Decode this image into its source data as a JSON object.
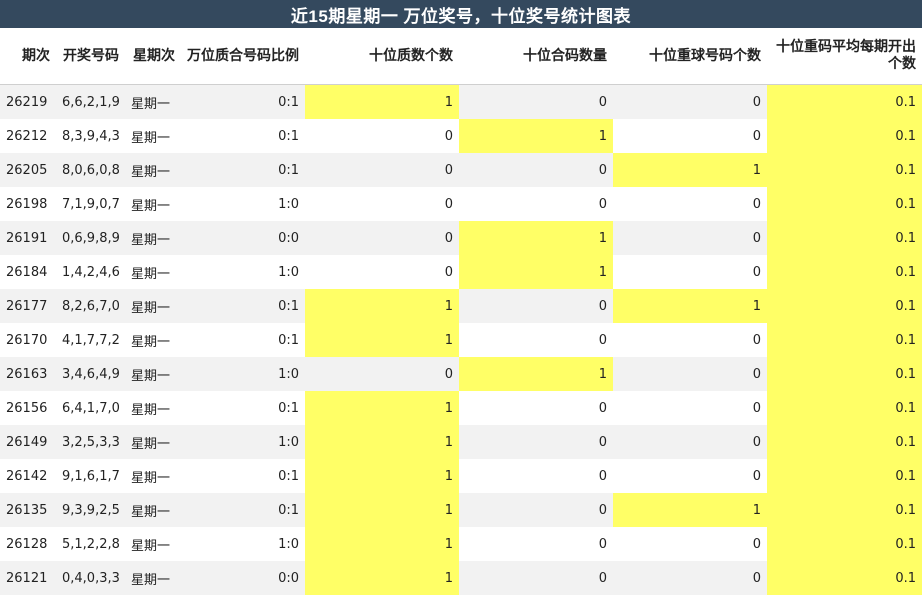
{
  "title": "近15期星期一 万位奖号，十位奖号统计图表",
  "highlight_color": "#ffff66",
  "header_color": "#34495e",
  "columns": [
    "期次",
    "开奖号码",
    "星期次",
    "万位质合号码比例",
    "十位质数个数",
    "十位合码数量",
    "十位重球号码个数",
    "十位重码平均每期开出个数"
  ],
  "rows": [
    {
      "period": "26219",
      "numbers": "6,6,2,1,9",
      "weekday": "星期一",
      "ratio": "0:1",
      "prime_count": "1",
      "composite_count": "0",
      "repeat_count": "0",
      "repeat_avg": "0.1"
    },
    {
      "period": "26212",
      "numbers": "8,3,9,4,3",
      "weekday": "星期一",
      "ratio": "0:1",
      "prime_count": "0",
      "composite_count": "1",
      "repeat_count": "0",
      "repeat_avg": "0.1"
    },
    {
      "period": "26205",
      "numbers": "8,0,6,0,8",
      "weekday": "星期一",
      "ratio": "0:1",
      "prime_count": "0",
      "composite_count": "0",
      "repeat_count": "1",
      "repeat_avg": "0.1"
    },
    {
      "period": "26198",
      "numbers": "7,1,9,0,7",
      "weekday": "星期一",
      "ratio": "1:0",
      "prime_count": "0",
      "composite_count": "0",
      "repeat_count": "0",
      "repeat_avg": "0.1"
    },
    {
      "period": "26191",
      "numbers": "0,6,9,8,9",
      "weekday": "星期一",
      "ratio": "0:0",
      "prime_count": "0",
      "composite_count": "1",
      "repeat_count": "0",
      "repeat_avg": "0.1"
    },
    {
      "period": "26184",
      "numbers": "1,4,2,4,6",
      "weekday": "星期一",
      "ratio": "1:0",
      "prime_count": "0",
      "composite_count": "1",
      "repeat_count": "0",
      "repeat_avg": "0.1"
    },
    {
      "period": "26177",
      "numbers": "8,2,6,7,0",
      "weekday": "星期一",
      "ratio": "0:1",
      "prime_count": "1",
      "composite_count": "0",
      "repeat_count": "1",
      "repeat_avg": "0.1"
    },
    {
      "period": "26170",
      "numbers": "4,1,7,7,2",
      "weekday": "星期一",
      "ratio": "0:1",
      "prime_count": "1",
      "composite_count": "0",
      "repeat_count": "0",
      "repeat_avg": "0.1"
    },
    {
      "period": "26163",
      "numbers": "3,4,6,4,9",
      "weekday": "星期一",
      "ratio": "1:0",
      "prime_count": "0",
      "composite_count": "1",
      "repeat_count": "0",
      "repeat_avg": "0.1"
    },
    {
      "period": "26156",
      "numbers": "6,4,1,7,0",
      "weekday": "星期一",
      "ratio": "0:1",
      "prime_count": "1",
      "composite_count": "0",
      "repeat_count": "0",
      "repeat_avg": "0.1"
    },
    {
      "period": "26149",
      "numbers": "3,2,5,3,3",
      "weekday": "星期一",
      "ratio": "1:0",
      "prime_count": "1",
      "composite_count": "0",
      "repeat_count": "0",
      "repeat_avg": "0.1"
    },
    {
      "period": "26142",
      "numbers": "9,1,6,1,7",
      "weekday": "星期一",
      "ratio": "0:1",
      "prime_count": "1",
      "composite_count": "0",
      "repeat_count": "0",
      "repeat_avg": "0.1"
    },
    {
      "period": "26135",
      "numbers": "9,3,9,2,5",
      "weekday": "星期一",
      "ratio": "0:1",
      "prime_count": "1",
      "composite_count": "0",
      "repeat_count": "1",
      "repeat_avg": "0.1"
    },
    {
      "period": "26128",
      "numbers": "5,1,2,2,8",
      "weekday": "星期一",
      "ratio": "1:0",
      "prime_count": "1",
      "composite_count": "0",
      "repeat_count": "0",
      "repeat_avg": "0.1"
    },
    {
      "period": "26121",
      "numbers": "0,4,0,3,3",
      "weekday": "星期一",
      "ratio": "0:0",
      "prime_count": "1",
      "composite_count": "0",
      "repeat_count": "0",
      "repeat_avg": "0.1"
    }
  ]
}
